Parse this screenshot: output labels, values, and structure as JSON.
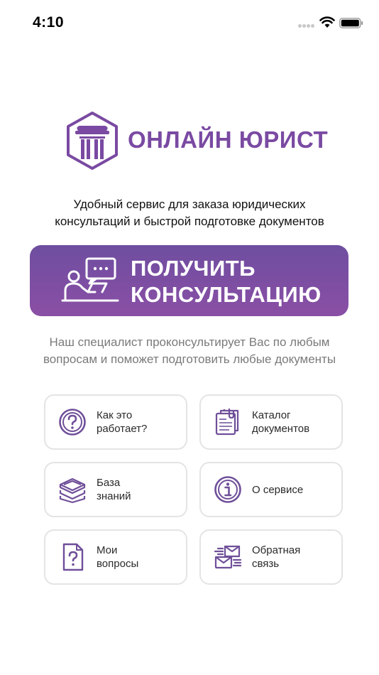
{
  "status_bar": {
    "time": "4:10"
  },
  "logo": {
    "text": "ОНЛАЙН ЮРИСТ",
    "brand_color": "#7a4aa2"
  },
  "tagline": {
    "line1": "Удобный сервис для заказа юридических",
    "line2": "консультаций и быстрой подготовке документов"
  },
  "cta": {
    "line1": "ПОЛУЧИТЬ",
    "line2": "КОНСУЛЬТАЦИЮ",
    "gradient_top": "#6e4ea0",
    "gradient_bottom": "#8a4fa5"
  },
  "description": {
    "line1": "Наш специалист проконсультирует Вас по любым",
    "line2": "вопросам и поможет подготовить любые документы"
  },
  "menu": {
    "how_it_works": {
      "label": "Как это\nработает?",
      "icon": "question-circle-icon"
    },
    "catalog": {
      "label": "Каталог\nдокументов",
      "icon": "document-catalog-icon"
    },
    "knowledge_base": {
      "label": "База\nзнаний",
      "icon": "layers-icon"
    },
    "about": {
      "label": "О сервисе",
      "icon": "info-circle-icon"
    },
    "my_questions": {
      "label": "Мои\nвопросы",
      "icon": "question-document-icon"
    },
    "feedback": {
      "label": "Обратная\nсвязь",
      "icon": "mail-send-icon"
    }
  }
}
